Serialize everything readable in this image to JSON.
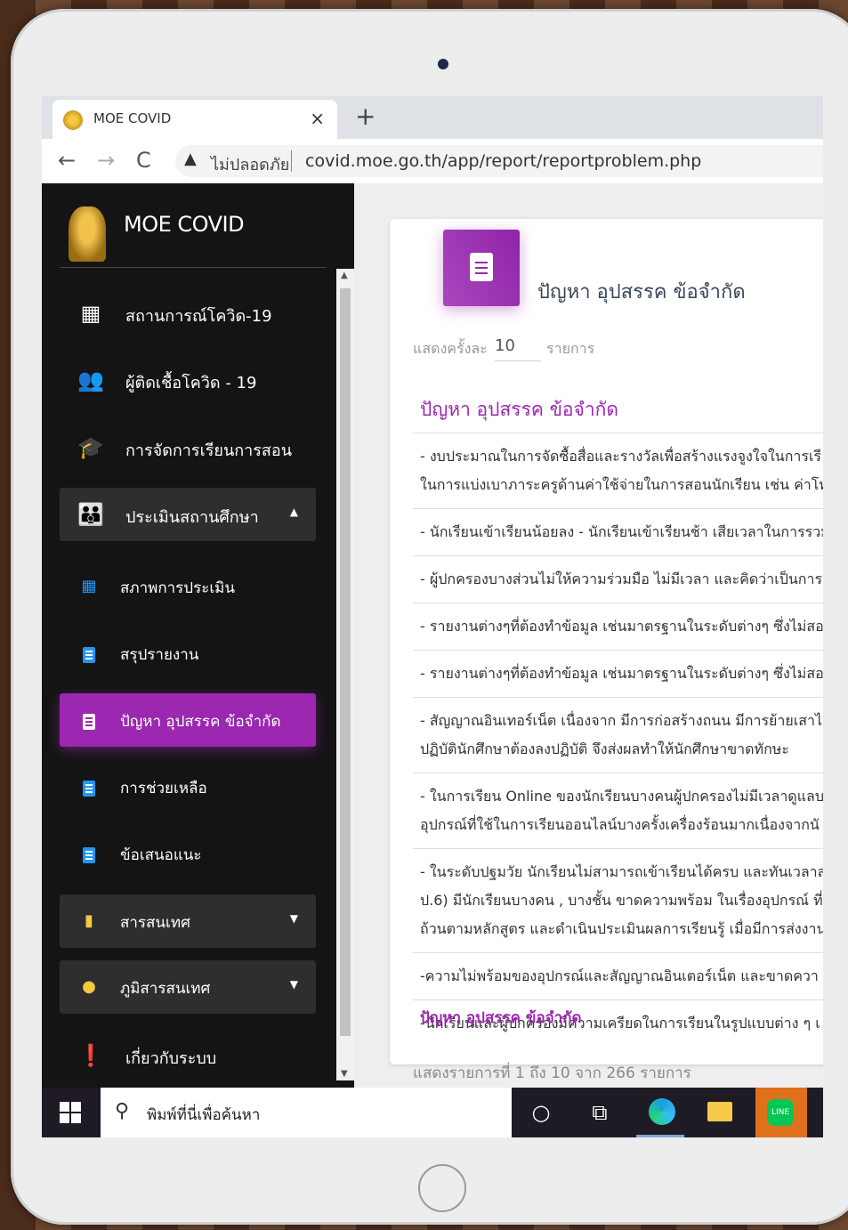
{
  "browser": {
    "tab_title": "MOE COVID",
    "tab_close": "×",
    "new_tab": "+",
    "back": "←",
    "forward": "→",
    "reload": "C",
    "security_label": "ไม่ปลอดภัย",
    "url": "covid.moe.go.th/app/report/reportproblem.php"
  },
  "sidebar": {
    "brand": "MOE COVID",
    "items": [
      {
        "label": "สถานการณ์โควิด-19",
        "icon": "dashboard-icon"
      },
      {
        "label": "ผู้ติดเชื้อโควิด - 19",
        "icon": "users-icon"
      },
      {
        "label": "การจัดการเรียนการสอน",
        "icon": "graduation-cap-icon"
      },
      {
        "label": "ประเมินสถานศึกษา",
        "icon": "family-icon",
        "caret": "▲"
      },
      {
        "label": "สภาพการประเมิน",
        "icon": "grid-icon"
      },
      {
        "label": "สรุปรายงาน",
        "icon": "document-icon"
      },
      {
        "label": "ปัญหา อุปสรรค ข้อจำกัด",
        "icon": "document-icon"
      },
      {
        "label": "การช่วยเหลือ",
        "icon": "document-icon"
      },
      {
        "label": "ข้อเสนอแนะ",
        "icon": "document-icon"
      },
      {
        "label": "สารสนเทศ",
        "icon": "bar-chart-icon",
        "caret": "▼"
      },
      {
        "label": "ภูมิสารสนเทศ",
        "icon": "globe-icon",
        "caret": "▼"
      },
      {
        "label": "เกี่ยวกับระบบ",
        "icon": "feedback-icon"
      }
    ]
  },
  "main": {
    "card_title": "ปัญหา อุปสรรค ข้อจำกัด",
    "show_label": "แสดงครั้งละ",
    "show_value": "10",
    "show_unit": "รายการ",
    "list_title": "ปัญหา อุปสรรค ข้อจำกัด",
    "rows": [
      [
        "- งบประมาณในการจัดซื้อสื่อและรางวัลเพื่อสร้างแรงจูงใจในการเรี",
        "ในการแบ่งเบาภาระครูด้านค่าใช้จ่ายในการสอนนักเรียน เช่น ค่าโทร"
      ],
      [
        "- นักเรียนเข้าเรียนน้อยลง - นักเรียนเข้าเรียนช้า เสียเวลาในการรวม"
      ],
      [
        "- ผู้ปกครองบางส่วนไม่ให้ความร่วมมือ ไม่มีเวลา และคิดว่าเป็นการ"
      ],
      [
        "- รายงานต่างๆที่ต้องทำข้อมูล เช่นมาตรฐานในระดับต่างๆ ซึ่งไม่สอ"
      ],
      [
        "- รายงานต่างๆที่ต้องทำข้อมูล เช่นมาตรฐานในระดับต่างๆ ซึ่งไม่สอ"
      ],
      [
        "- สัญญาณอินเทอร์เน็ต เนื่องจาก มีการก่อสร้างถนน มีการย้ายเสาไ",
        "ปฏิบัตินักศึกษาต้องลงปฏิบัติ จึงส่งผลทำให้นักศึกษาขาดทักษะ"
      ],
      [
        "- ในการเรียน Online ของนักเรียนบางคนผู้ปกครองไม่มีเวลาดูแลบ",
        "อุปกรณ์ที่ใช้ในการเรียนออนไลน์บางครั้งเครื่องร้อนมากเนื่องจากนั"
      ],
      [
        "- ในระดับปฐมวัย นักเรียนไม่สามารถเข้าเรียนได้ครบ และทันเวลาส",
        "ป.6) มีนักเรียนบางคน , บางชั้น ขาดความพร้อม ในเรื่องอุปกรณ์ ที่",
        "ถ้วนตามหลักสูตร และดำเนินประเมินผลการเรียนรู้ เมื่อมีการส่งงาน"
      ],
      [
        "-ความไม่พร้อมของอุปกรณ์และสัญญาณอินเตอร์เน็ต และขาดควา"
      ],
      [
        "-นักเรียนและผู้ปกครองมีความเครียดในการเรียนในรูปแบบต่าง ๆ เ"
      ]
    ],
    "list_footer": "ปัญหา อุปสรรค ข้อจำกัด",
    "info": "แสดงรายการที่ 1 ถึง 10 จาก 266 รายการ"
  },
  "taskbar": {
    "search_placeholder": "พิมพ์ที่นี่เพื่อค้นหา",
    "line_label": "LINE"
  },
  "colors": {
    "accent": "#9c27b0",
    "sidebar_bg": "#141414",
    "doc_icon": "#2196f3"
  }
}
